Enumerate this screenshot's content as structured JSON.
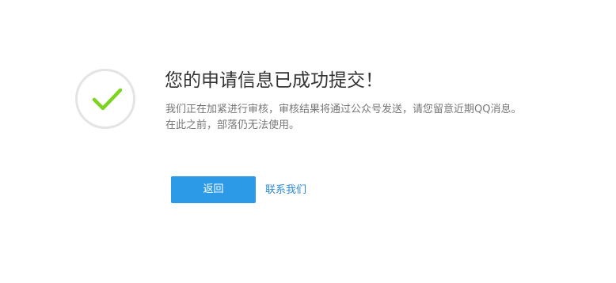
{
  "result": {
    "icon": "checkmark-icon",
    "check_color": "#7ed321",
    "ring_color": "#e4e4e4",
    "title": "您的申请信息已成功提交！",
    "message_line1": "我们正在加紧进行审核，审核结果将通过公众号发送，请您留意近期QQ消息。",
    "message_line2": "在此之前，部落仍无法使用。"
  },
  "actions": {
    "back_label": "返回",
    "contact_label": "联系我们",
    "accent_color": "#2d9ae8"
  }
}
